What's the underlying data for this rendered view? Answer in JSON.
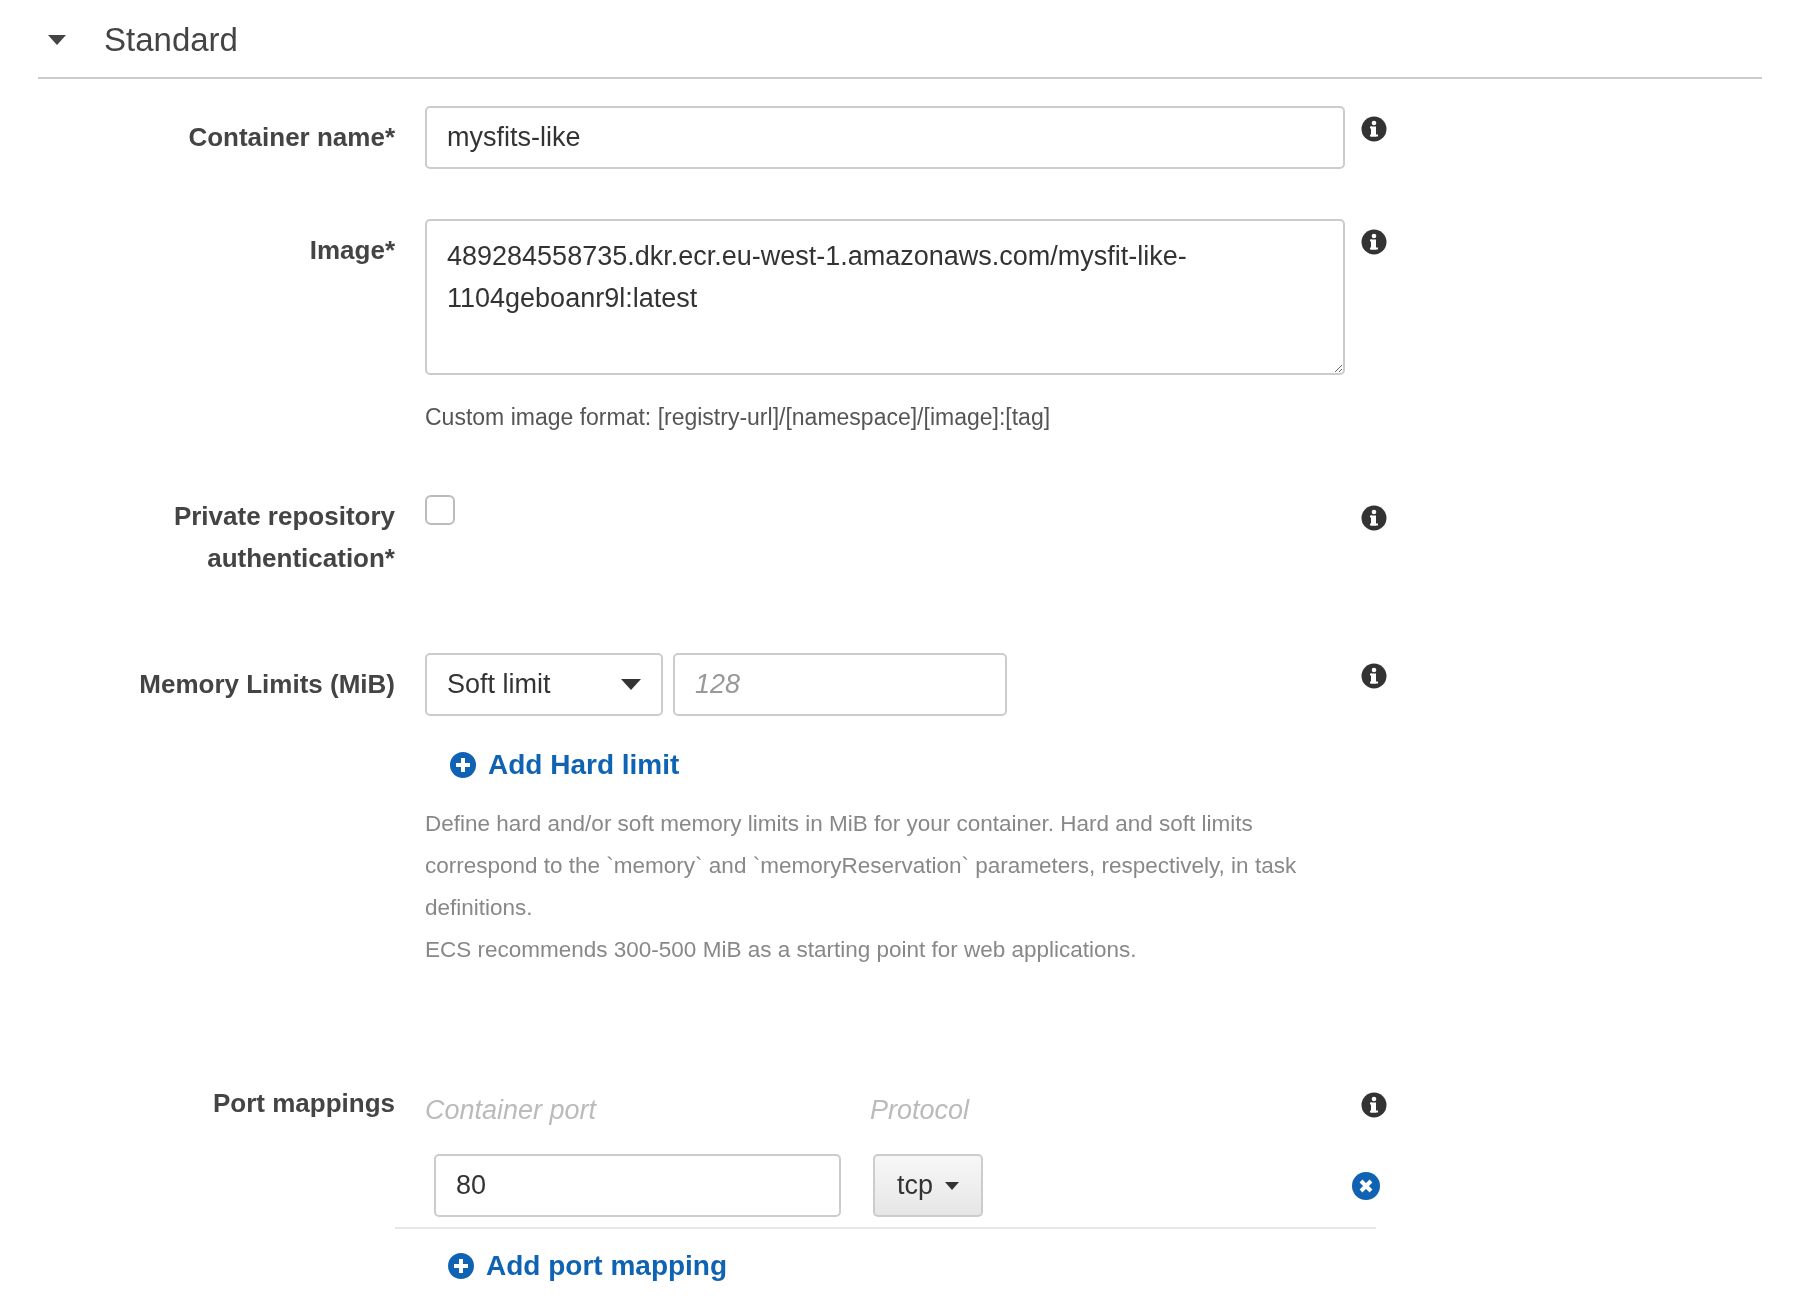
{
  "section": {
    "title": "Standard",
    "expanded": true
  },
  "fields": [
    {
      "kind": "text",
      "label": "Container name*",
      "value": "mysfits-like"
    },
    {
      "kind": "textarea",
      "label": "Image*",
      "value": "489284558735.dkr.ecr.eu-west-1.amazonaws.com/mysfit-like-1104geboanr9l:latest",
      "help": "Custom image format: [registry-url]/[namespace]/[image]:[tag]"
    },
    {
      "kind": "checkbox",
      "label": "Private repository authentication*",
      "checked": false
    },
    {
      "kind": "memory",
      "label": "Memory Limits (MiB)",
      "select": "Soft limit",
      "placeholder": "128",
      "link": "Add Hard limit",
      "help": [
        "Define hard and/or soft memory limits in MiB for your container. Hard and soft limits correspond to the `memory` and `memoryReservation` parameters, respectively, in task definitions.",
        "ECS recommends 300-500 MiB as a starting point for web applications."
      ]
    }
  ],
  "port_mappings": {
    "label": "Port mappings",
    "columns": [
      "Container port",
      "Protocol"
    ],
    "rows": [
      {
        "container_port": "80",
        "protocol": "tcp"
      }
    ],
    "add_link": "Add port mapping"
  }
}
